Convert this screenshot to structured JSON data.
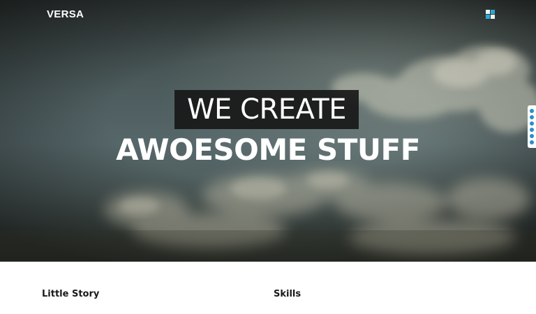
{
  "header": {
    "brand": "VERSA",
    "menu_icon": "grid-menu-icon"
  },
  "hero": {
    "headline_line1": "WE CREATE",
    "headline_line2": "AWOESOME STUFF",
    "dot_nav_count": 6
  },
  "sections": {
    "left_title": "Little Story",
    "right_title": "Skills"
  },
  "colors": {
    "accent": "#29a9d8",
    "dot_nav": "#2b8fc9",
    "headline_box": "#181818",
    "text_dark": "#1a1a1a"
  }
}
